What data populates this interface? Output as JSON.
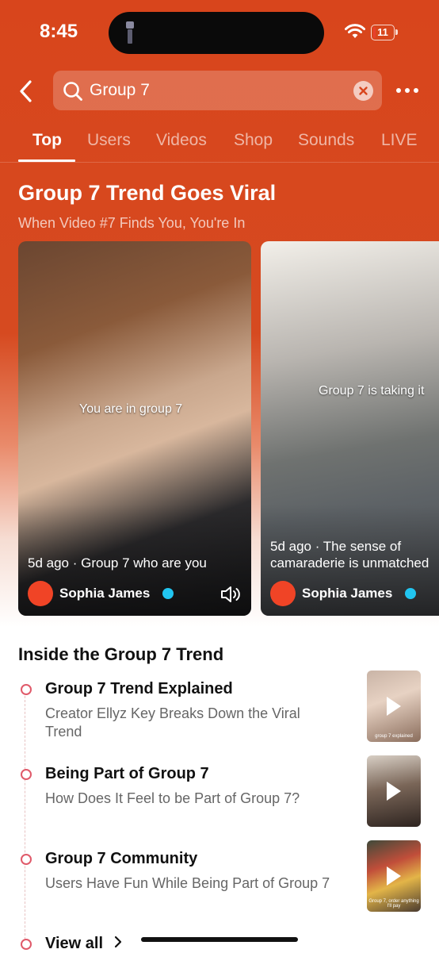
{
  "status_bar": {
    "time": "8:45",
    "battery": "11",
    "battery_level": 0.11
  },
  "search": {
    "query": "Group 7"
  },
  "tabs": [
    {
      "label": "Top",
      "active": true
    },
    {
      "label": "Users"
    },
    {
      "label": "Videos"
    },
    {
      "label": "Shop"
    },
    {
      "label": "Sounds"
    },
    {
      "label": "LIVE"
    }
  ],
  "hero": {
    "title": "Group 7 Trend Goes Viral",
    "subtitle": "When Video #7 Finds You, You're In",
    "cards": [
      {
        "overlay": "You are in group 7",
        "caption": "5d ago · Group 7 who are you",
        "author": "Sophia James"
      },
      {
        "overlay": "Group 7 is taking it",
        "caption": "5d ago · The sense of camaraderie is unmatched",
        "author": "Sophia James"
      }
    ]
  },
  "section": {
    "title": "Inside the Group 7 Trend",
    "items": [
      {
        "title": "Group 7 Trend Explained",
        "desc": "Creator Ellyz Key Breaks Down the Viral Trend",
        "thumb_caption": "group 7 explained"
      },
      {
        "title": "Being Part of Group 7",
        "desc": "How Does It Feel to be Part of Group 7?",
        "thumb_caption": ""
      },
      {
        "title": "Group 7 Community",
        "desc": "Users Have Fun While Being Part of Group 7",
        "thumb_caption": "Group 7, order anything I'll pay"
      }
    ],
    "view_all": "View all"
  },
  "colors": {
    "brand": "#d8451c",
    "verified": "#21c5f0",
    "avatar": "#f04426",
    "timeline_dot": "#e05a6a"
  }
}
